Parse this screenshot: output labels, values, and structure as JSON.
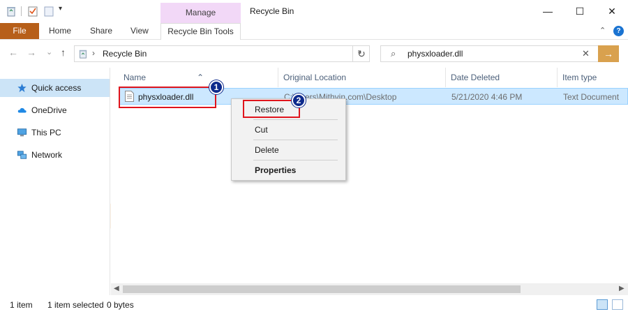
{
  "window": {
    "manage_tab": "Manage",
    "title": "Recycle Bin",
    "minimize": "—",
    "maximize": "☐",
    "close": "✕"
  },
  "ribbon": {
    "file": "File",
    "tabs": [
      "Home",
      "Share",
      "View"
    ],
    "context_tab": "Recycle Bin Tools",
    "collapse": "⌃",
    "help": "?"
  },
  "address_bar": {
    "back": "←",
    "forward": "→",
    "recent": "⌄",
    "up": "↑",
    "separator": "›",
    "crumb": "Recycle Bin",
    "dropdown": "⌄",
    "refresh": "↻"
  },
  "search": {
    "value": "physxloader.dll",
    "clear": "✕",
    "go": "→"
  },
  "nav_pane": {
    "items": [
      {
        "label": "Quick access",
        "icon": "star-icon",
        "selected": true
      },
      {
        "label": "OneDrive",
        "icon": "cloud-icon",
        "selected": false
      },
      {
        "label": "This PC",
        "icon": "computer-icon",
        "selected": false
      },
      {
        "label": "Network",
        "icon": "network-icon",
        "selected": false
      }
    ]
  },
  "columns": {
    "name": "Name",
    "original_location": "Original Location",
    "date_deleted": "Date Deleted",
    "item_type": "Item type"
  },
  "file_row": {
    "name": "physxloader.dll",
    "original_location": "C:\\Users\\Mithvin.com\\Desktop",
    "date_deleted": "5/21/2020 4:46 PM",
    "item_type": "Text Document"
  },
  "context_menu": {
    "restore": "Restore",
    "cut": "Cut",
    "delete": "Delete",
    "properties": "Properties"
  },
  "annotations": {
    "badge_1": "1",
    "badge_2": "2"
  },
  "status_bar": {
    "item_count": "1 item",
    "selected": "1 item selected",
    "size": "0 bytes"
  },
  "scrollbar": {
    "left": "◀",
    "right": "▶"
  },
  "colors": {
    "file_tab": "#b75f19",
    "manage_tab": "#f2d8f7",
    "selection": "#cce8ff",
    "annotation_red": "#e0141c",
    "badge_blue": "#0d2a8c",
    "search_go": "#d9a14e"
  }
}
